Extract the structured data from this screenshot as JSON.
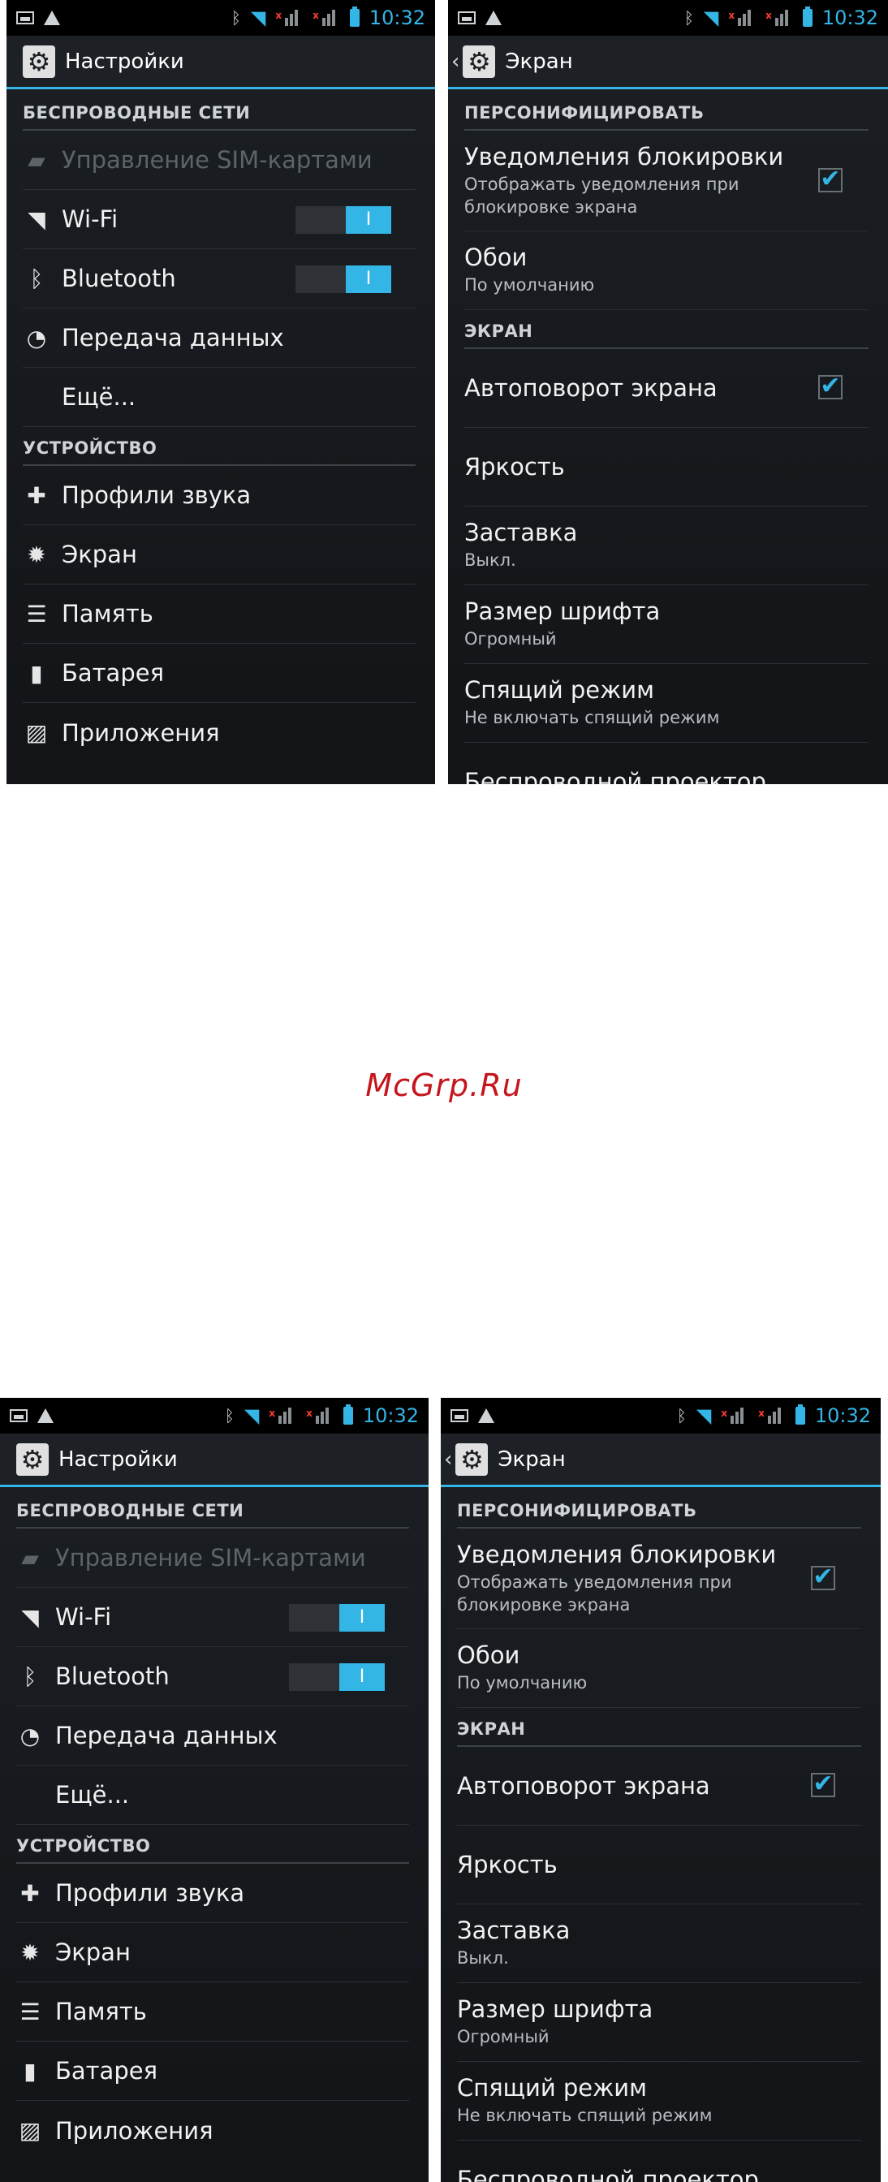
{
  "status": {
    "time": "10:32"
  },
  "settings": {
    "title": "Настройки",
    "sections": [
      {
        "header": "БЕСПРОВОДНЫЕ СЕТИ"
      },
      {
        "header": "УСТРОЙСТВО"
      }
    ],
    "items": {
      "sim": "Управление SIM-картами",
      "wifi": "Wi-Fi",
      "bluetooth": "Bluetooth",
      "data": "Передача данных",
      "more": "Ещё...",
      "sound": "Профили звука",
      "screen": "Экран",
      "memory": "Память",
      "battery": "Батарея",
      "apps": "Приложения"
    },
    "switch_on": "I"
  },
  "screen": {
    "title": "Экран",
    "sections": [
      {
        "header": "ПЕРСОНИФИЦИРОВАТЬ"
      },
      {
        "header": "ЭКРАН"
      }
    ],
    "prefs": {
      "lock_notif": {
        "title": "Уведомления блокировки",
        "summary": "Отображать уведомления при блокировке экрана",
        "checked": true
      },
      "wallpaper": {
        "title": "Обои",
        "summary": "По умолчанию"
      },
      "autorotate": {
        "title": "Автоповорот экрана",
        "checked": true
      },
      "brightness": {
        "title": "Яркость"
      },
      "daydream": {
        "title": "Заставка",
        "summary": "Выкл."
      },
      "font_size": {
        "title": "Размер шрифта",
        "summary": "Огромный"
      },
      "sleep": {
        "title": "Спящий режим",
        "summary": "Не включать спящий режим"
      },
      "projector": {
        "title": "Беспроводной проектор"
      }
    },
    "check_mark": "✔"
  },
  "watermark": "McGrp.Ru",
  "colors": {
    "accent": "#33b5e5",
    "watermark": "#c4161c"
  }
}
